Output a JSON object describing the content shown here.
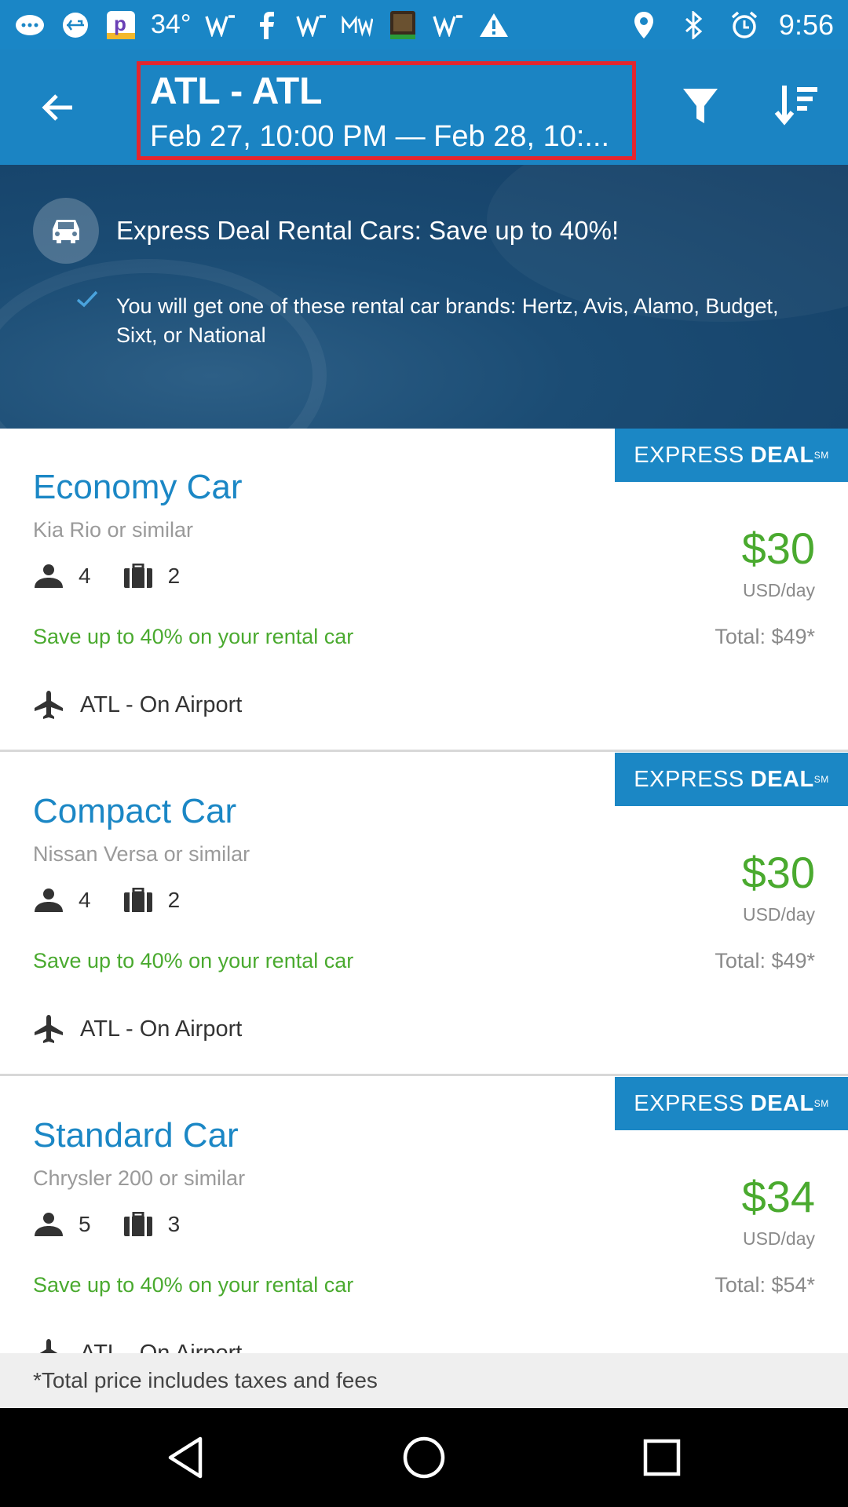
{
  "status_bar": {
    "temperature": "34°",
    "time": "9:56",
    "icons": [
      "chat-icon",
      "usb-icon",
      "p-app-icon",
      "w-icon",
      "facebook-icon",
      "w-icon",
      "mw-icon",
      "bible-icon",
      "w-icon",
      "warning-icon",
      "location-icon",
      "bluetooth-icon",
      "alarm-icon"
    ]
  },
  "app_bar": {
    "title": "ATL - ATL",
    "subtitle": "Feb 27, 10:00 PM — Feb 28, 10:..."
  },
  "banner": {
    "title": "Express Deal Rental Cars: Save up to 40%!",
    "text": "You will get one of these rental car brands: Hertz, Avis, Alamo, Budget, Sixt, or National"
  },
  "badge": {
    "part1": "EXPRESS",
    "part2": "DEAL",
    "mark": "SM"
  },
  "cars": [
    {
      "title": "Economy Car",
      "model": "Kia Rio or similar",
      "passengers": "4",
      "bags": "2",
      "price": "$30",
      "per_day": "USD/day",
      "save": "Save up to 40% on your rental car",
      "total": "Total: $49*",
      "location": "ATL - On Airport"
    },
    {
      "title": "Compact Car",
      "model": "Nissan Versa or similar",
      "passengers": "4",
      "bags": "2",
      "price": "$30",
      "per_day": "USD/day",
      "save": "Save up to 40% on your rental car",
      "total": "Total: $49*",
      "location": "ATL - On Airport"
    },
    {
      "title": "Standard Car",
      "model": "Chrysler 200 or similar",
      "passengers": "5",
      "bags": "3",
      "price": "$34",
      "per_day": "USD/day",
      "save": "Save up to 40% on your rental car",
      "total": "Total: $54*",
      "location": "ATL - On Airport"
    }
  ],
  "footer_note": "*Total price includes taxes and fees",
  "colors": {
    "app_bar": "#1b84c3",
    "accent_blue": "#1b87c5",
    "price_green": "#4aaa2f",
    "highlight_red": "#e3262f"
  }
}
